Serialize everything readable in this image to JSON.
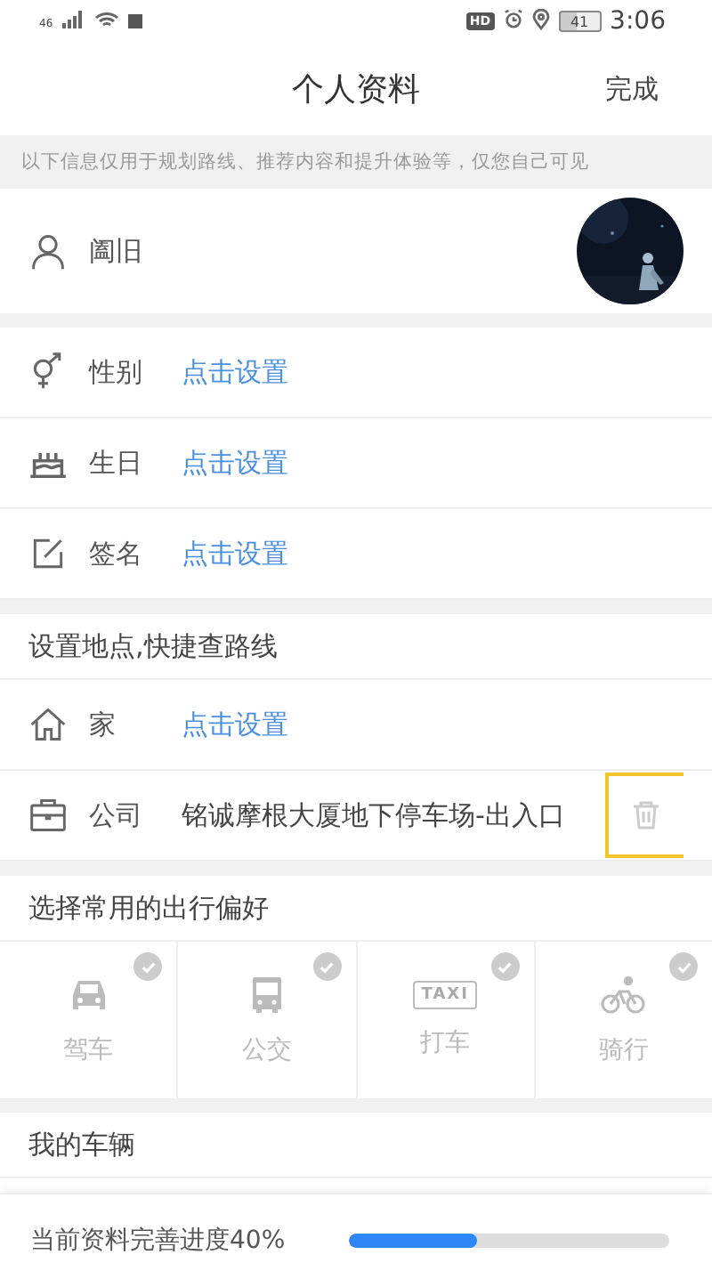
{
  "status_bar": {
    "network": "46",
    "hd": "HD",
    "battery": "41",
    "time": "3:06"
  },
  "header": {
    "title": "个人资料",
    "action": "完成"
  },
  "notice": "以下信息仅用于规划路线、推荐内容和提升体验等，仅您自己可见",
  "profile": {
    "name": "阖旧"
  },
  "basic_items": [
    {
      "label": "性别",
      "kind": "link",
      "value": "点击设置"
    },
    {
      "label": "生日",
      "kind": "link",
      "value": "点击设置"
    },
    {
      "label": "签名",
      "kind": "link",
      "value": "点击设置"
    }
  ],
  "places": {
    "title": "设置地点,快捷查路线",
    "items": [
      {
        "label": "家",
        "kind": "link",
        "value": "点击设置"
      },
      {
        "label": "公司",
        "kind": "value",
        "value": "铭诚摩根大厦地下停车场-出入口",
        "deletable": true,
        "highlighted": true
      }
    ]
  },
  "preferences": {
    "title": "选择常用的出行偏好",
    "modes": [
      {
        "kind": "car",
        "label": "驾车",
        "selected": false
      },
      {
        "kind": "bus",
        "label": "公交",
        "selected": false
      },
      {
        "kind": "taxi",
        "badge": "TAXI",
        "label": "打车",
        "selected": false
      },
      {
        "kind": "bike",
        "label": "骑行",
        "selected": false
      }
    ]
  },
  "vehicles": {
    "title": "我的车辆"
  },
  "progress": {
    "label": "当前资料完善进度40%",
    "level": 0.4
  }
}
